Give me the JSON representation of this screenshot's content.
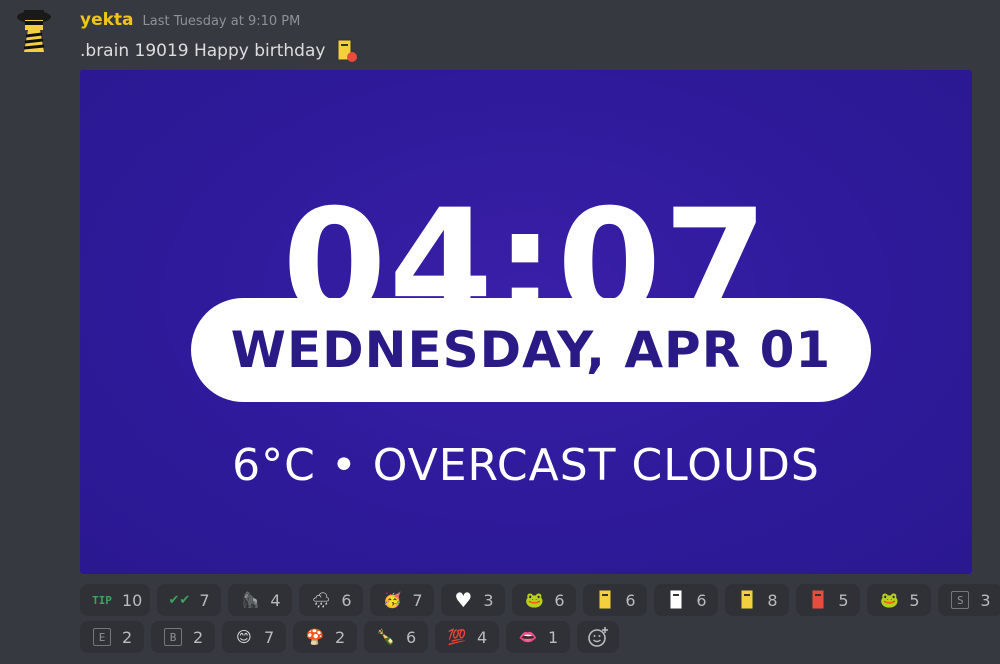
{
  "message": {
    "username": "yekta",
    "timestamp": "Last Tuesday at 9:10 PM",
    "content": ".brain 19019 Happy birthday"
  },
  "embed": {
    "time": "04:07",
    "date": "WEDNESDAY, APR 01",
    "weather": "6°C • OVERCAST CLOUDS",
    "background_color": "#2e1a9a",
    "pill_text_color": "#2a1a86"
  },
  "reactions": {
    "row1": [
      {
        "icon": "tip-icon",
        "glyph": "TIP",
        "count": "10"
      },
      {
        "icon": "double-check-icon",
        "glyph": "✔✔",
        "count": "7"
      },
      {
        "icon": "gorilla-icon",
        "glyph": "🦍",
        "count": "4"
      },
      {
        "icon": "rain-cloud-icon",
        "glyph": "🌧",
        "count": "6"
      },
      {
        "icon": "party-face-icon",
        "glyph": "🥳",
        "count": "7"
      },
      {
        "icon": "white-heart-icon",
        "glyph": "♥",
        "count": "3"
      },
      {
        "icon": "cool-pepe-icon",
        "glyph": "🐸",
        "count": "6"
      },
      {
        "icon": "yellow-card-icon",
        "glyph": "▮",
        "count": "6"
      },
      {
        "icon": "card-note-icon",
        "glyph": "▯",
        "count": "6"
      },
      {
        "icon": "card-heart-icon",
        "glyph": "▮",
        "count": "8"
      },
      {
        "icon": "red-card-icon",
        "glyph": "▮",
        "count": "5"
      },
      {
        "icon": "pepe-icon",
        "glyph": "🐸",
        "count": "5"
      },
      {
        "icon": "letter-s-icon",
        "glyph": "S",
        "count": "3"
      }
    ],
    "row2": [
      {
        "icon": "letter-e-icon",
        "glyph": "E",
        "count": "2"
      },
      {
        "icon": "letter-b-icon",
        "glyph": "B",
        "count": "2"
      },
      {
        "icon": "blob-icon",
        "glyph": "😊",
        "count": "7"
      },
      {
        "icon": "mushroom-icon",
        "glyph": "🍄",
        "count": "2"
      },
      {
        "icon": "champagne-icon",
        "glyph": "🍾",
        "count": "6"
      },
      {
        "icon": "hundred-icon",
        "glyph": "💯",
        "count": "4"
      },
      {
        "icon": "lips-icon",
        "glyph": "👄",
        "count": "1"
      }
    ]
  },
  "colors": {
    "background": "#36393f",
    "username": "#f0c419",
    "reaction_bg": "#2f3136"
  }
}
